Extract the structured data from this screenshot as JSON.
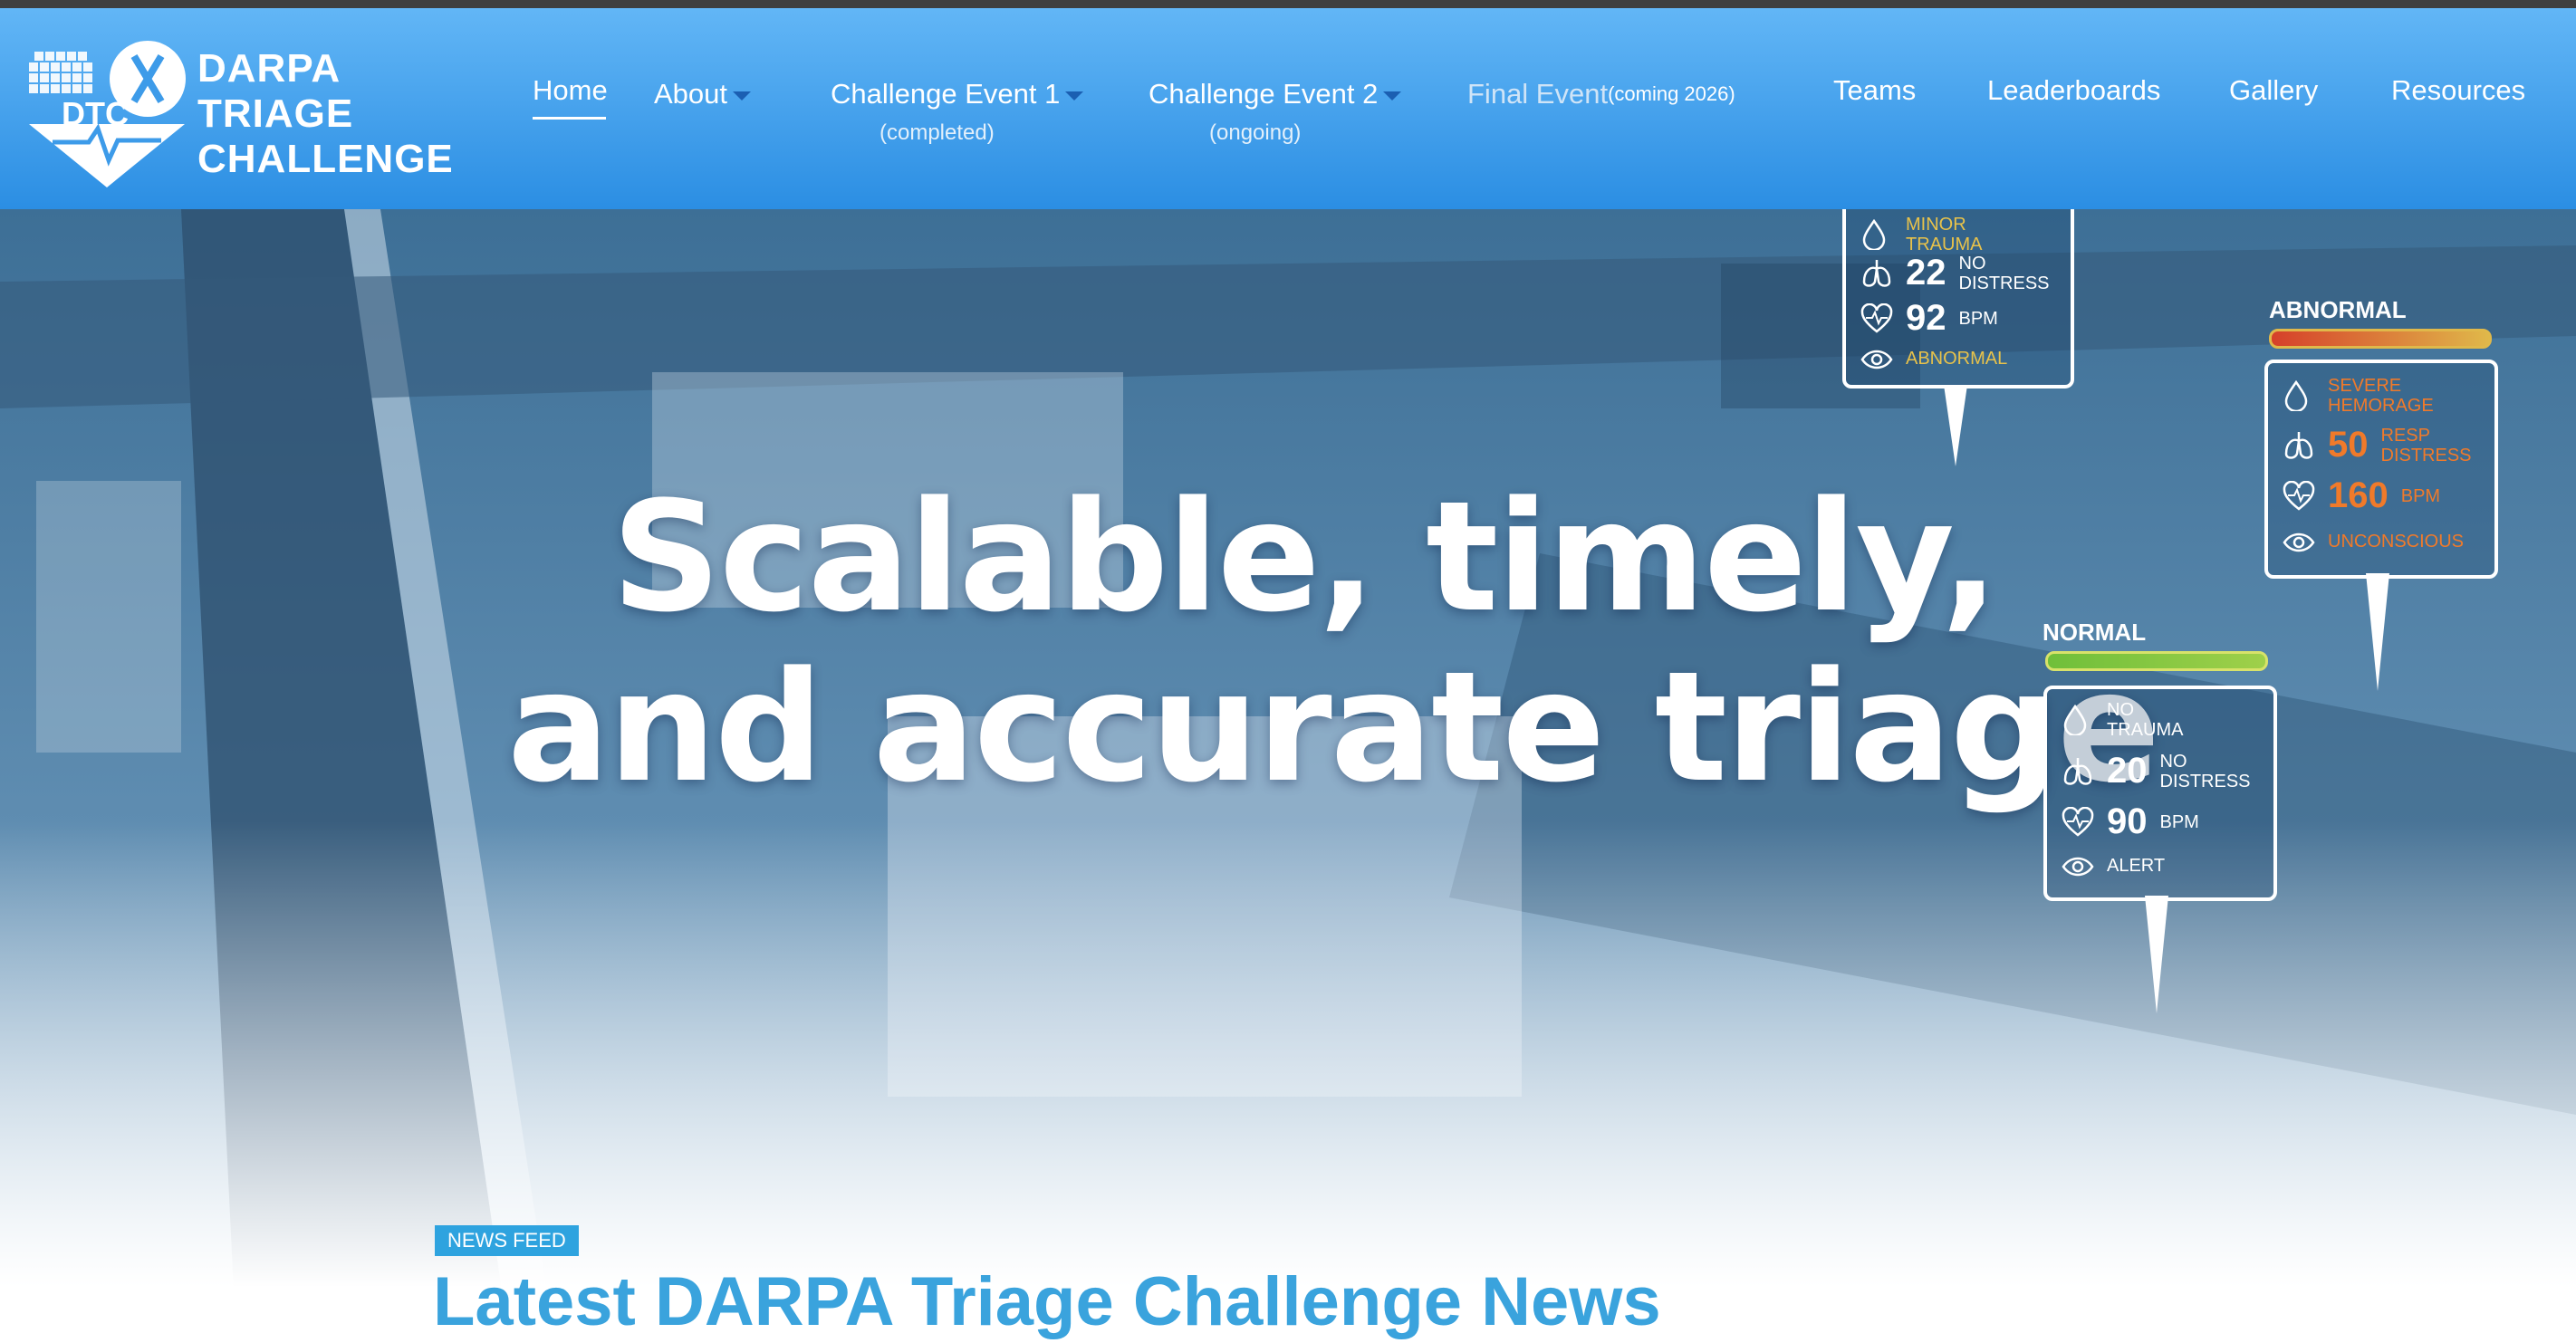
{
  "logo": {
    "abbrev": "DTC",
    "line1": "DARPA",
    "line2": "TRIAGE",
    "line3": "CHALLENGE"
  },
  "nav": {
    "home": "Home",
    "about": "About",
    "event1": "Challenge Event 1",
    "event1_sub": "(completed)",
    "event2": "Challenge Event 2",
    "event2_sub": "(ongoing)",
    "final": "Final Event",
    "final_sub": "(coming 2026)",
    "teams": "Teams",
    "leaderboards": "Leaderboards",
    "gallery": "Gallery",
    "resources": "Resources"
  },
  "hero": {
    "line1": "Scalable, timely,",
    "line2": "and accurate triage"
  },
  "cards": {
    "top": {
      "trauma": "MINOR TRAUMA",
      "resp_value": "22",
      "resp_label": "NO DISTRESS",
      "hr_value": "92",
      "hr_label": "BPM",
      "alert": "ABNORMAL"
    },
    "abnormal": {
      "status": "ABNORMAL",
      "trauma": "SEVERE HEMORAGE",
      "resp_value": "50",
      "resp_label": "RESP DISTRESS",
      "hr_value": "160",
      "hr_label": "BPM",
      "alert": "UNCONSCIOUS",
      "bar_level": 1.0
    },
    "normal": {
      "status": "NORMAL",
      "trauma": "NO TRAUMA",
      "resp_value": "20",
      "resp_label": "NO DISTRESS",
      "hr_value": "90",
      "hr_label": "BPM",
      "alert": "ALERT",
      "bar_level": 0.8
    }
  },
  "news": {
    "badge": "NEWS FEED",
    "title": "Latest DARPA Triage Challenge News"
  },
  "colors": {
    "header_top": "#62b6f6",
    "header_bottom": "#2b8ee3",
    "accent": "#3aa3dd",
    "badge": "#2ea3df",
    "abnormal_text": "#f07a2a",
    "top_card_text": "#e8c24a"
  },
  "icons": {
    "blood": "drop-icon",
    "lungs": "lungs-icon",
    "heart": "heart-pulse-icon",
    "eye": "eye-icon",
    "caret": "caret-down-icon"
  }
}
